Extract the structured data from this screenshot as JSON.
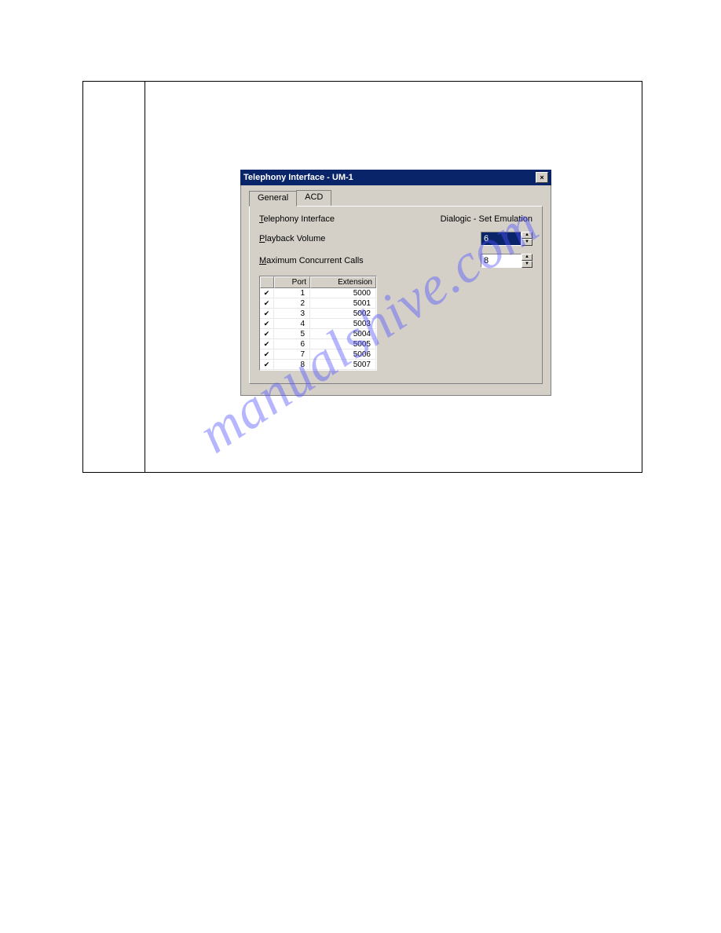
{
  "watermark": "manualshive.com",
  "dialog": {
    "title": "Telephony Interface - UM-1",
    "close_glyph": "×",
    "tabs": {
      "general": "General",
      "acd": "ACD"
    },
    "interface_label_pre": "T",
    "interface_label_rest": "elephony Interface",
    "interface_value": "Dialogic - Set Emulation",
    "playback_label_pre": "P",
    "playback_label_rest": "layback Volume",
    "playback_value": "6",
    "maxcalls_label_pre": "M",
    "maxcalls_label_rest": "aximum Concurrent Calls",
    "maxcalls_value": "8",
    "spin_up": "▲",
    "spin_down": "▼",
    "grid": {
      "col_chk": "",
      "col_port": "Port",
      "col_ext": "Extension",
      "rows": [
        {
          "chk": "✔",
          "port": "1",
          "ext": "5000"
        },
        {
          "chk": "✔",
          "port": "2",
          "ext": "5001"
        },
        {
          "chk": "✔",
          "port": "3",
          "ext": "5002"
        },
        {
          "chk": "✔",
          "port": "4",
          "ext": "5003"
        },
        {
          "chk": "✔",
          "port": "5",
          "ext": "5004"
        },
        {
          "chk": "✔",
          "port": "6",
          "ext": "5005"
        },
        {
          "chk": "✔",
          "port": "7",
          "ext": "5006"
        },
        {
          "chk": "✔",
          "port": "8",
          "ext": "5007"
        }
      ]
    }
  }
}
